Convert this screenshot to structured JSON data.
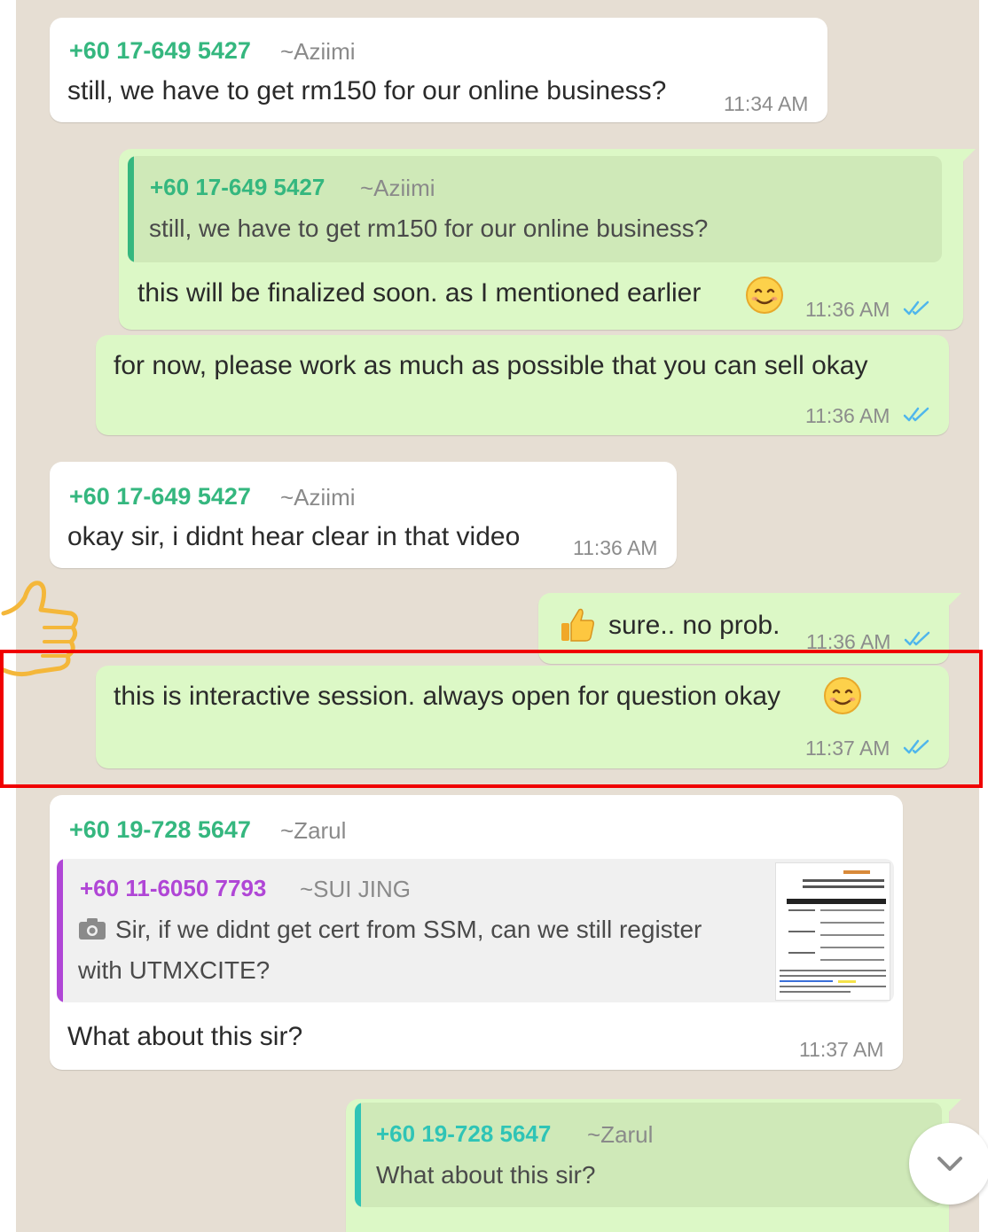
{
  "messages": [
    {
      "id": "m1",
      "sender_number": "+60 17-649 5427",
      "sender_name": "~Aziimi",
      "text": "still, we have to get rm150 for our online business?",
      "time": "11:34 AM"
    },
    {
      "id": "m2",
      "quote": {
        "sender_number": "+60 17-649 5427",
        "sender_name": "~Aziimi",
        "text": "still, we have to get rm150 for our online business?"
      },
      "text": "this will be finalized soon. as I mentioned earlier",
      "emoji": "smiling-face",
      "time": "11:36 AM"
    },
    {
      "id": "m3",
      "text": "for now, please work as much as possible that you can sell okay",
      "time": "11:36 AM"
    },
    {
      "id": "m4",
      "sender_number": "+60 17-649 5427",
      "sender_name": "~Aziimi",
      "text": "okay sir, i didnt hear clear in that video",
      "time": "11:36 AM"
    },
    {
      "id": "m5",
      "emoji": "thumbs-up",
      "text": "sure.. no prob.",
      "time": "11:36 AM"
    },
    {
      "id": "m6",
      "text": "this is interactive session. always open for question okay",
      "emoji": "smiling-face",
      "time": "11:37 AM"
    },
    {
      "id": "m7",
      "sender_number": "+60 19-728 5647",
      "sender_name": "~Zarul",
      "quote": {
        "sender_number": "+60 11-6050 7793",
        "sender_name": "~SUI JING",
        "text_line1": "Sir, if we didnt get cert from SSM, can we still register",
        "text_line2": "with UTMXCITE?",
        "media": "photo"
      },
      "text": "What about this sir?",
      "time": "11:37 AM"
    },
    {
      "id": "m8",
      "quote": {
        "sender_number": "+60 19-728 5647",
        "sender_name": "~Zarul",
        "text": "What about this sir?"
      }
    }
  ],
  "colors": {
    "outgoing_bubble": "#dcf8c6",
    "incoming_bubble": "#ffffff",
    "sender_green": "#35b77f",
    "sender_purple": "#b046d6",
    "read_ticks": "#4fb6ec",
    "highlight": "#f00000",
    "annotation_thumb": "#f4b73a"
  },
  "icons": {
    "read_receipt": "double-check-icon",
    "scroll": "chevron-down-icon",
    "photo": "camera-icon"
  }
}
